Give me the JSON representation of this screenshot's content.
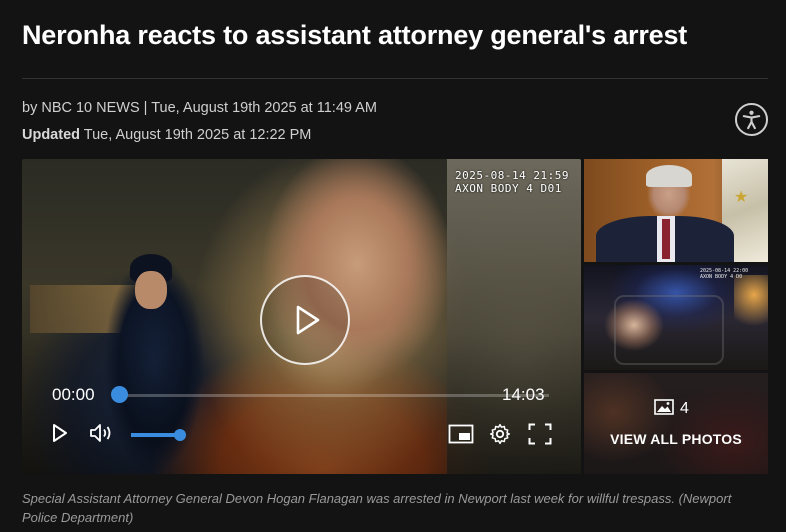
{
  "article": {
    "headline": "Neronha reacts to assistant attorney general's arrest",
    "byline": "by NBC 10 NEWS | Tue, August 19th 2025 at 11:49 AM",
    "updated_label": "Updated",
    "updated_time": "Tue, August 19th 2025 at 12:22 PM",
    "caption": "Special Assistant Attorney General Devon Hogan Flanagan was arrested in Newport last week for willful trespass. (Newport Police Department)"
  },
  "video": {
    "overlay_stamp": "2025-08-14 21:59\nAXON BODY 4 D01",
    "current_time": "00:00",
    "duration": "14:03",
    "progress": 0,
    "volume": 1.0
  },
  "thumbnails": {
    "thumb2_stamp": "2025-08-14 22:00\nAXON BODY 4 D0",
    "photo_count": "4",
    "view_all_label": "VIEW ALL PHOTOS"
  },
  "icons": {
    "accessibility": "accessibility-icon",
    "play": "play-icon",
    "volume": "volume-icon",
    "pip": "picture-in-picture-icon",
    "settings": "gear-icon",
    "fullscreen": "fullscreen-icon",
    "gallery": "image-icon"
  },
  "colors": {
    "accent": "#3a8dde",
    "background": "#131313"
  }
}
